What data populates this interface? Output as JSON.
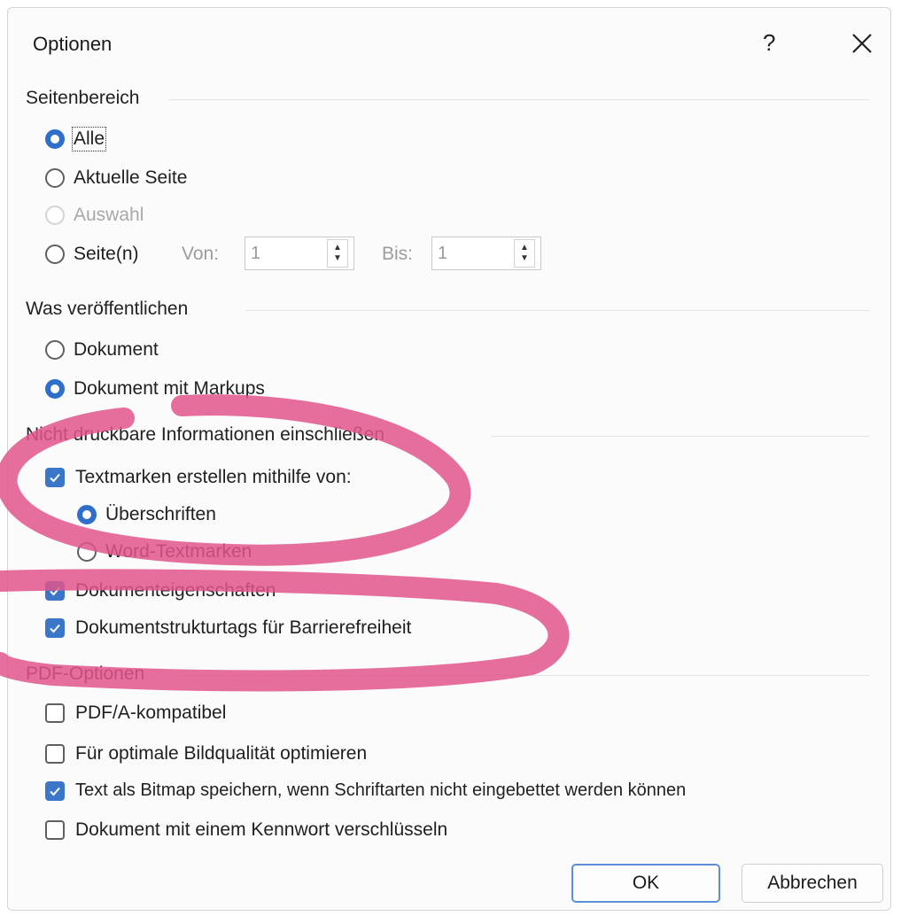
{
  "dialog": {
    "title": "Optionen",
    "help_label": "?"
  },
  "seitenbereich": {
    "heading": "Seitenbereich",
    "options": {
      "alle": "Alle",
      "aktuelle_seite": "Aktuelle Seite",
      "auswahl": "Auswahl",
      "seiten": "Seite(n)"
    },
    "von_label": "Von:",
    "von_value": "1",
    "bis_label": "Bis:",
    "bis_value": "1"
  },
  "was_veroeffentlichen": {
    "heading": "Was veröffentlichen",
    "options": {
      "dokument": "Dokument",
      "dokument_markups": "Dokument mit Markups"
    }
  },
  "nicht_druckbar": {
    "heading": "Nicht druckbare Informationen einschließen",
    "textmarken": "Textmarken erstellen mithilfe von:",
    "ueberschriften": "Überschriften",
    "word_textmarken": "Word-Textmarken",
    "eigenschaften": "Dokumenteigenschaften",
    "strukturtags": "Dokumentstrukturtags für Barrierefreiheit"
  },
  "pdf_optionen": {
    "heading": "PDF-Optionen",
    "pdfa": "PDF/A-kompatibel",
    "bildqualitaet": "Für optimale Bildqualität optimieren",
    "bitmap": "Text als Bitmap speichern, wenn Schriftarten nicht eingebettet werden können",
    "kennwort": "Dokument mit einem Kennwort verschlüsseln"
  },
  "buttons": {
    "ok": "OK",
    "abbrechen": "Abbrechen"
  },
  "colors": {
    "accent": "#3b77c9",
    "marker": "#e0558c"
  },
  "icons": {
    "close": "close-icon",
    "checkmark": "checkmark-icon",
    "spin": "spin-arrows-icon"
  }
}
